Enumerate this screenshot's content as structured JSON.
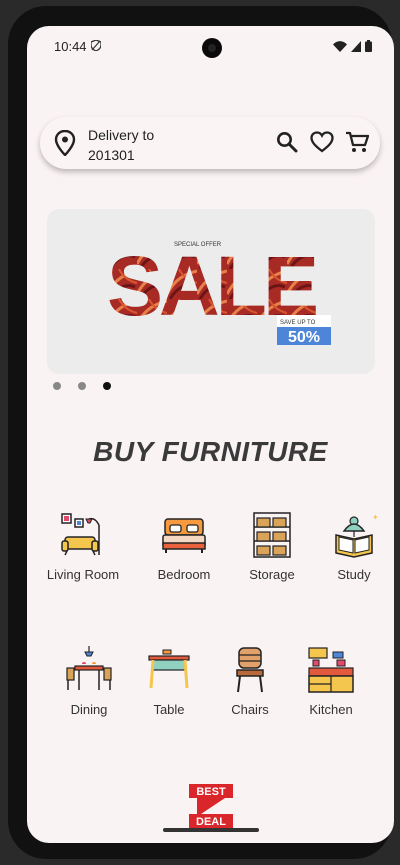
{
  "status": {
    "time": "10:44"
  },
  "header": {
    "delivery_label": "Delivery to",
    "pincode": "201301"
  },
  "banner": {
    "special_offer": "SPECIAL OFFER",
    "title": "SALE",
    "save_text": "SAVE UP TO",
    "percent": "50%"
  },
  "carousel": {
    "count": 3,
    "active": 2
  },
  "section_title": "BUY FURNITURE",
  "categories": [
    {
      "label": "Living Room",
      "icon": "living-room-icon"
    },
    {
      "label": "Bedroom",
      "icon": "bed-icon"
    },
    {
      "label": "Storage",
      "icon": "shelf-icon"
    },
    {
      "label": "Study",
      "icon": "study-icon"
    },
    {
      "label": "Dining",
      "icon": "dining-icon"
    },
    {
      "label": "Table",
      "icon": "table-icon"
    },
    {
      "label": "Chairs",
      "icon": "chair-icon"
    },
    {
      "label": "Kitchen",
      "icon": "kitchen-icon"
    }
  ],
  "logo": {
    "line1": "BEST",
    "line2": "DEAL"
  },
  "colors": {
    "brand_red": "#d9262b",
    "accent_blue": "#2f77d6"
  }
}
